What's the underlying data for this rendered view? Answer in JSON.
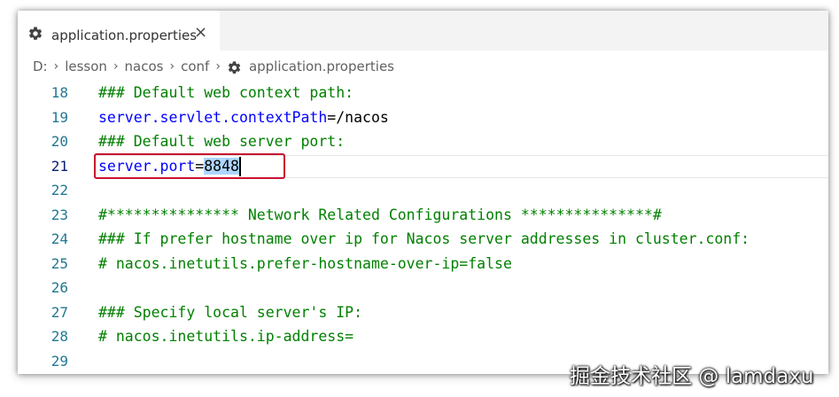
{
  "tab": {
    "icon": "gear-icon",
    "label": "application.properties",
    "close_glyph": "×"
  },
  "breadcrumb": {
    "items": [
      "D:",
      "lesson",
      "nacos",
      "conf"
    ],
    "file_icon": "gear-icon",
    "file": "application.properties",
    "separator": "›"
  },
  "editor": {
    "active_line": 21,
    "lines": [
      {
        "num": "18",
        "tokens": [
          {
            "t": "### Default web context path:",
            "c": "comment"
          }
        ]
      },
      {
        "num": "19",
        "tokens": [
          {
            "t": "server.servlet.contextPath",
            "c": "key"
          },
          {
            "t": "=/nacos",
            "c": "val"
          }
        ]
      },
      {
        "num": "20",
        "tokens": [
          {
            "t": "### Default web server port:",
            "c": "comment"
          }
        ]
      },
      {
        "num": "21",
        "tokens": [
          {
            "t": "server.port",
            "c": "key"
          },
          {
            "t": "=",
            "c": "val"
          },
          {
            "t": "8848",
            "c": "val",
            "sel": true
          }
        ]
      },
      {
        "num": "22",
        "tokens": []
      },
      {
        "num": "23",
        "tokens": [
          {
            "t": "#*************** Network Related Configurations ***************#",
            "c": "comment"
          }
        ]
      },
      {
        "num": "24",
        "tokens": [
          {
            "t": "### If prefer hostname over ip for Nacos server addresses in cluster.conf:",
            "c": "comment"
          }
        ]
      },
      {
        "num": "25",
        "tokens": [
          {
            "t": "# nacos.inetutils.prefer-hostname-over-ip=false",
            "c": "comment"
          }
        ]
      },
      {
        "num": "26",
        "tokens": []
      },
      {
        "num": "27",
        "tokens": [
          {
            "t": "### Specify local server's IP:",
            "c": "comment"
          }
        ]
      },
      {
        "num": "28",
        "tokens": [
          {
            "t": "# nacos.inetutils.ip-address=",
            "c": "comment"
          }
        ]
      },
      {
        "num": "29",
        "tokens": []
      }
    ]
  },
  "colors": {
    "comment": "#008000",
    "key": "#0000ff",
    "line_number": "#237893",
    "highlight_box": "#c8102e",
    "selection": "#add6ff"
  },
  "watermark": "掘金技术社区 @ lamdaxu"
}
